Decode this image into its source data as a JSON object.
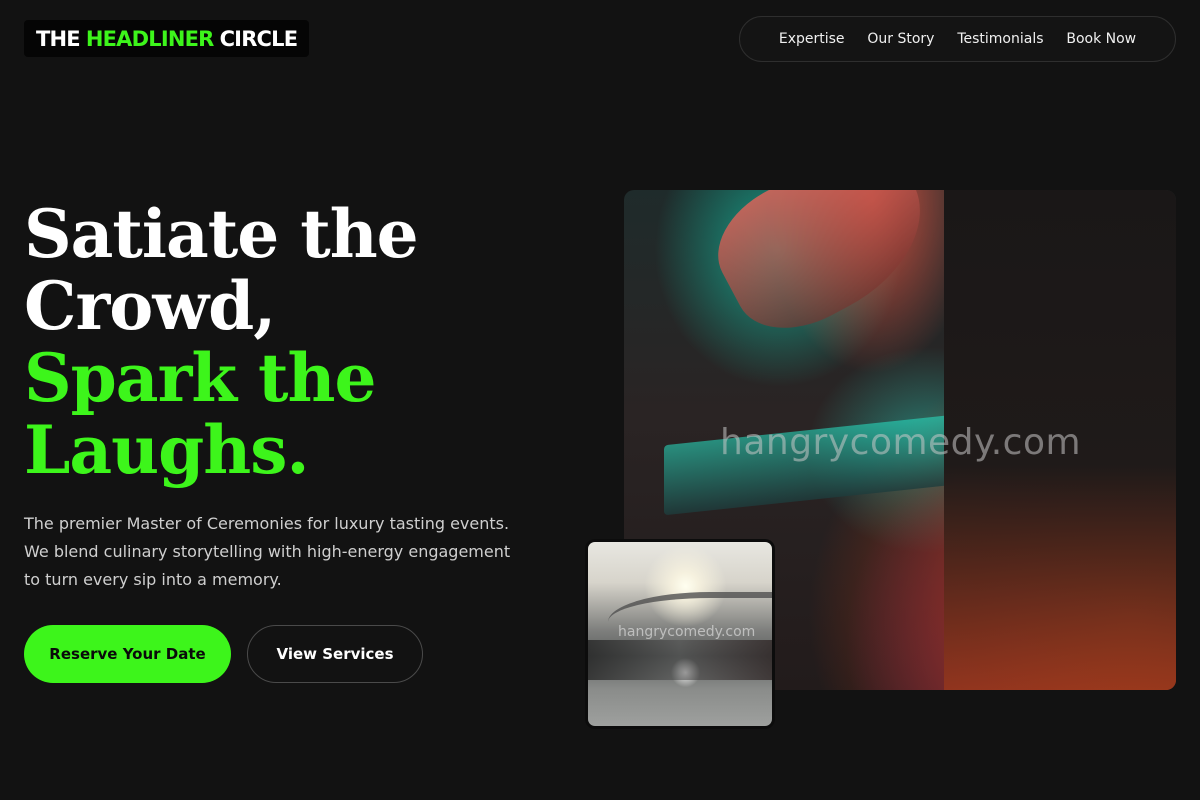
{
  "header": {
    "logo_part1": "THE",
    "logo_part2": "HEADLINER",
    "logo_part3": "CIRCLE",
    "nav": [
      "Expertise",
      "Our Story",
      "Testimonials",
      "Book Now"
    ]
  },
  "hero": {
    "headline_line1": "Satiate the",
    "headline_line2": "Crowd,",
    "headline_line3": "Spark the",
    "headline_line4": "Laughs.",
    "description": "The premier Master of Ceremonies for luxury tasting events. We blend culinary storytelling with high-energy engagement to turn every sip into a memory.",
    "primary_button": "Reserve Your Date",
    "secondary_button": "View Services"
  },
  "images": {
    "main_watermark": "hangrycomedy.com",
    "small_watermark": "hangrycomedy.com"
  },
  "colors": {
    "background": "#121212",
    "accent": "#3df51b",
    "text": "#ffffff"
  }
}
